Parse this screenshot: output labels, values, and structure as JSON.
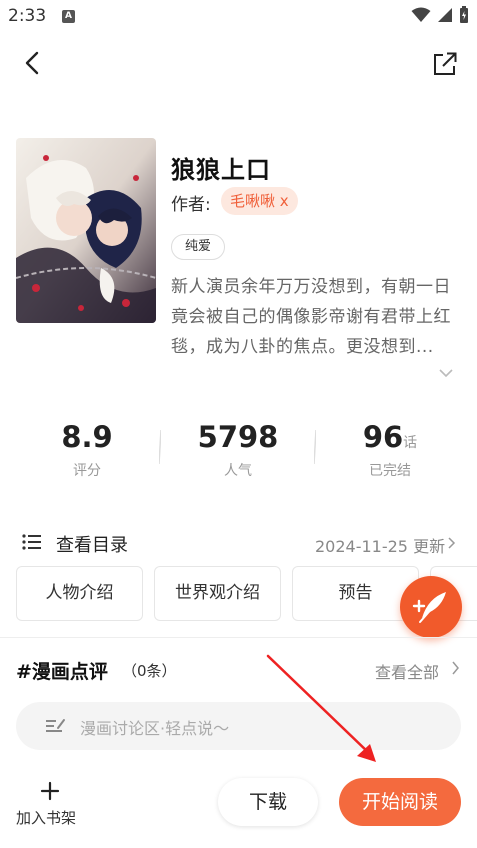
{
  "status_bar": {
    "time": "2:33",
    "notification_badge": "A"
  },
  "comic": {
    "title": "狼狼上口",
    "author_label": "作者:",
    "author_name": "毛啾啾 x",
    "tag": "纯爱",
    "description": "新人演员余年万万没想到，有朝一日竟会被自己的偶像影帝谢有君带上红毯，成为八卦的焦点。更没想到..."
  },
  "stats": {
    "rating_value": "8.9",
    "rating_label": "评分",
    "popularity_value": "5798",
    "popularity_label": "人气",
    "episodes_value": "96",
    "episodes_unit": "话",
    "episodes_label": "已完结"
  },
  "catalog": {
    "label": "查看目录",
    "update_text": "2024-11-25 更新"
  },
  "info_buttons": [
    "人物介绍",
    "世界观介绍",
    "预告"
  ],
  "reviews": {
    "title": "#漫画点评",
    "count": "（0条）",
    "view_all": "查看全部",
    "comment_placeholder": "漫画讨论区·轻点说～"
  },
  "bottom_bar": {
    "shelf_label": "加入书架",
    "download_label": "下载",
    "read_label": "开始阅读"
  },
  "colors": {
    "accent": "#f46a3e",
    "author_chip_bg": "#fde8df",
    "annotation_arrow": "#ee2222"
  }
}
